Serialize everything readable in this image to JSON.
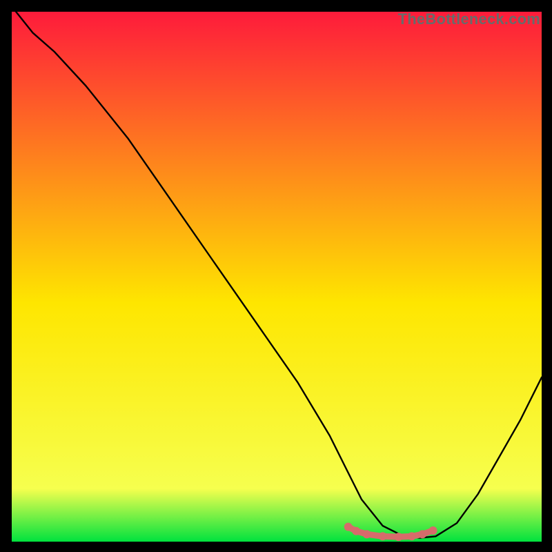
{
  "watermark": "TheBottleneck.com",
  "colors": {
    "top": "#fe1b3b",
    "mid": "#fee600",
    "low": "#f6ff4e",
    "bottom": "#00e23e",
    "curve": "#000000",
    "marker": "#d76b6b",
    "background": "#000000"
  },
  "chart_data": {
    "type": "line",
    "title": "",
    "xlabel": "",
    "ylabel": "",
    "xlim": [
      0,
      100
    ],
    "ylim": [
      0,
      100
    ],
    "annotations": [],
    "series": [
      {
        "name": "bottleneck-curve",
        "x": [
          0,
          4,
          8,
          14,
          22,
          30,
          38,
          46,
          54,
          60,
          63,
          66,
          70,
          74,
          77,
          80,
          84,
          88,
          92,
          96,
          100
        ],
        "values": [
          101,
          96,
          92.5,
          86,
          76,
          64.5,
          53,
          41.5,
          30,
          20,
          14,
          8,
          3,
          1,
          0.7,
          1,
          3.5,
          9,
          16,
          23,
          31
        ]
      }
    ],
    "markers": {
      "name": "min-region",
      "x": [
        63.5,
        65,
        67,
        70,
        73,
        75.5,
        77.5,
        79.5
      ],
      "values": [
        2.8,
        2.0,
        1.4,
        1.0,
        0.9,
        1.0,
        1.4,
        2.1
      ]
    }
  }
}
